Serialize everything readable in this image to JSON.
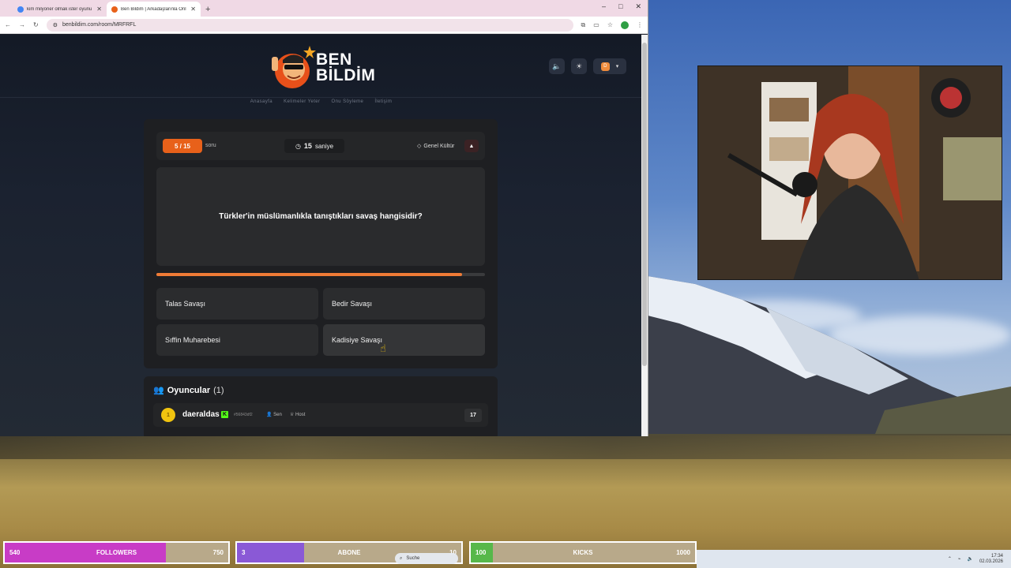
{
  "browser": {
    "tabs": [
      {
        "title": "kim milyoner olmak ister oyunu",
        "active": false,
        "favicon_color": "#4285f4"
      },
      {
        "title": "Ben Bildim | Arkadaşlarınla Onl",
        "active": true,
        "favicon_color": "#e8611a"
      }
    ],
    "new_tab": "+",
    "url": "benbildim.com/room/MRFRFL",
    "window_controls": [
      "–",
      "□",
      "✕"
    ]
  },
  "site": {
    "logo_line1": "BEN",
    "logo_line2": "BİLDİM",
    "nav": [
      "Anasayfa",
      "Kelimeler Yeter",
      "Onu Söyleme",
      "İletişim"
    ],
    "user_initial": "D"
  },
  "quiz": {
    "counter": "5 / 15",
    "counter_suffix": "soru",
    "timer_value": "15",
    "timer_unit": "saniye",
    "category": "Genel Kültür",
    "question": "Türkler'in müslümanlıkla tanıştıkları savaş hangisidir?",
    "progress_fraction": 0.93,
    "answers": [
      "Talas Savaşı",
      "Bedir Savaşı",
      "Sıffin Muharebesi",
      "Kadisiye Savaşı"
    ],
    "accent_color": "#e8611a"
  },
  "players": {
    "title": "Oyuncular",
    "count": "(1)",
    "list": [
      {
        "rank": "1",
        "name": "daeraldas",
        "id": "#56843df2",
        "you_label": "Sen",
        "host_label": "Host",
        "score": "17"
      }
    ]
  },
  "goals": [
    {
      "current": "540",
      "label": "FOLLOWERS",
      "max": "750",
      "fraction": 0.72,
      "color": "#c83cc6"
    },
    {
      "current": "3",
      "label": "ABONE",
      "max": "10",
      "fraction": 0.3,
      "color": "#8a59d6"
    },
    {
      "current": "100",
      "label": "KICKS",
      "max": "1000",
      "fraction": 0.1,
      "color": "#57b84a"
    }
  ],
  "taskbar": {
    "search": "Suche",
    "time": "17:34",
    "date": "02.03.2026"
  }
}
